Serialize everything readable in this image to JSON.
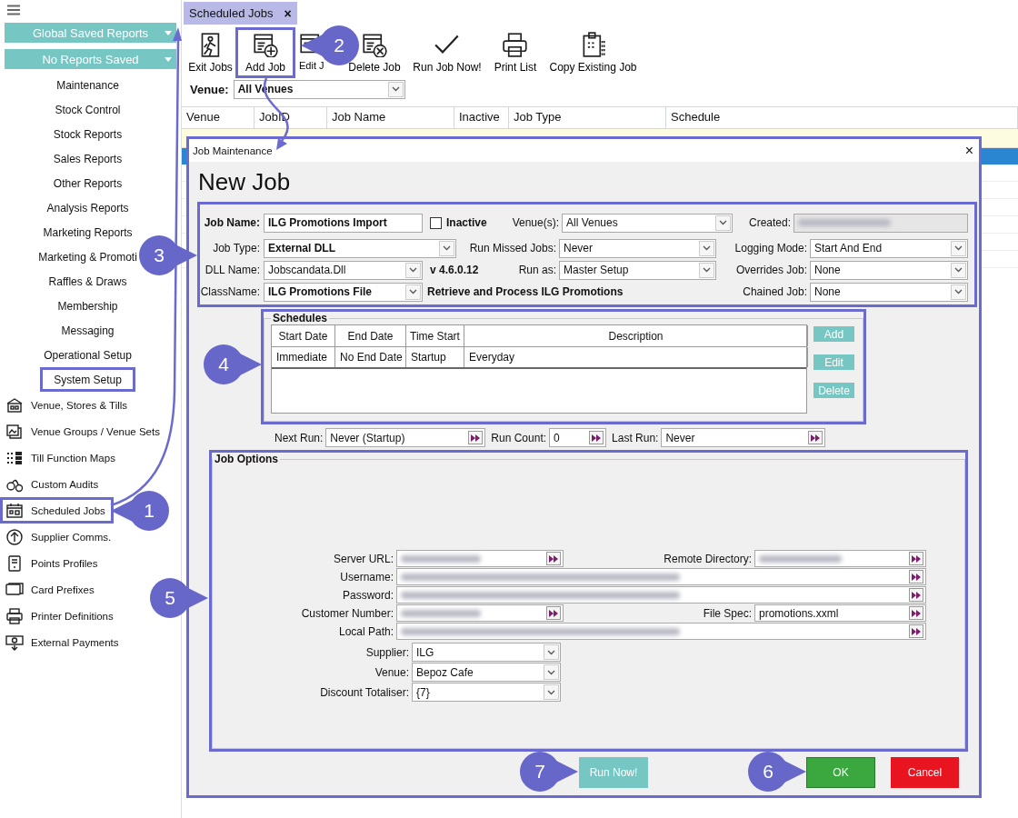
{
  "sidebar": {
    "report_selectors": [
      {
        "label": "Global Saved Reports"
      },
      {
        "label": "No Reports Saved"
      }
    ],
    "menu_items": [
      {
        "label": "Maintenance",
        "highlighted": false
      },
      {
        "label": "Stock Control",
        "highlighted": false
      },
      {
        "label": "Stock Reports",
        "highlighted": false
      },
      {
        "label": "Sales Reports",
        "highlighted": false
      },
      {
        "label": "Other Reports",
        "highlighted": false
      },
      {
        "label": "Analysis Reports",
        "highlighted": false
      },
      {
        "label": "Marketing Reports",
        "highlighted": false
      },
      {
        "label": "Marketing & Promoti",
        "highlighted": false
      },
      {
        "label": "Raffles & Draws",
        "highlighted": false
      },
      {
        "label": "Membership",
        "highlighted": false
      },
      {
        "label": "Messaging",
        "highlighted": false
      },
      {
        "label": "Operational Setup",
        "highlighted": false
      },
      {
        "label": "System Setup",
        "highlighted": true
      }
    ],
    "setup_items": [
      {
        "label": "Venue, Stores & Tills",
        "highlighted": false
      },
      {
        "label": "Venue Groups / Venue Sets",
        "highlighted": false
      },
      {
        "label": "Till Function Maps",
        "highlighted": false
      },
      {
        "label": "Custom Audits",
        "highlighted": false
      },
      {
        "label": "Scheduled Jobs",
        "highlighted": true
      },
      {
        "label": "Supplier Comms.",
        "highlighted": false
      },
      {
        "label": "Points Profiles",
        "highlighted": false
      },
      {
        "label": "Card Prefixes",
        "highlighted": false
      },
      {
        "label": "Printer Definitions",
        "highlighted": false
      },
      {
        "label": "External Payments",
        "highlighted": false
      }
    ]
  },
  "tab": {
    "label": "Scheduled Jobs",
    "close": "×"
  },
  "toolbar": [
    {
      "label": "Exit Jobs",
      "highlighted": false
    },
    {
      "label": "Add Job",
      "highlighted": true
    },
    {
      "label": "Edit J",
      "highlighted": false
    },
    {
      "label": "Delete Job",
      "highlighted": false
    },
    {
      "label": "Run Job Now!",
      "highlighted": false
    },
    {
      "label": "Print List",
      "highlighted": false
    },
    {
      "label": "Copy Existing Job",
      "highlighted": false
    }
  ],
  "venue_filter": {
    "label": "Venue:",
    "value": "All Venues"
  },
  "table": {
    "columns": [
      "Venue",
      "JobID",
      "Job Name",
      "Inactive",
      "Job Type",
      "Schedule"
    ]
  },
  "dialog": {
    "title": "Job Maintenance",
    "close": "×",
    "heading": "New Job",
    "job": {
      "job_name": {
        "label": "Job Name:",
        "value": "ILG Promotions Import"
      },
      "inactive": {
        "label": "Inactive",
        "checked": false
      },
      "venues": {
        "label": "Venue(s):",
        "value": "All Venues"
      },
      "created": {
        "label": "Created:",
        "redacted": true
      },
      "job_type": {
        "label": "Job Type:",
        "value": "External DLL"
      },
      "run_missed_jobs": {
        "label": "Run Missed Jobs:",
        "value": "Never"
      },
      "logging_mode": {
        "label": "Logging Mode:",
        "value": "Start And End"
      },
      "dll_name": {
        "label": "DLL Name:",
        "value": "Jobscandata.Dll"
      },
      "version": "v 4.6.0.12",
      "run_as": {
        "label": "Run as:",
        "value": "Master Setup"
      },
      "overrides_job": {
        "label": "Overrides Job:",
        "value": "None"
      },
      "class_name": {
        "label": "ClassName:",
        "value": "ILG Promotions File"
      },
      "class_description": "Retrieve and Process ILG Promotions",
      "chained_job": {
        "label": "Chained Job:",
        "value": "None"
      }
    },
    "schedules": {
      "title": "Schedules",
      "columns": [
        "Start Date",
        "End Date",
        "Time Start",
        "Description"
      ],
      "rows": [
        [
          "Immediate",
          "No End Date",
          "Startup",
          "Everyday"
        ]
      ],
      "buttons": [
        "Add",
        "Edit",
        "Delete"
      ]
    },
    "run_info": [
      {
        "label": "Next Run:",
        "value": "Never (Startup)"
      },
      {
        "label": "Run Count:",
        "value": "0"
      },
      {
        "label": "Last Run:",
        "value": "Never"
      }
    ],
    "job_options": {
      "title": "Job Options",
      "fields": [
        {
          "kind": "pair",
          "left": {
            "label": "Server URL:",
            "redacted": true
          },
          "right": {
            "label": "Remote Directory:",
            "redacted": true
          }
        },
        {
          "kind": "wide",
          "label": "Username:",
          "redacted": true
        },
        {
          "kind": "wide",
          "label": "Password:",
          "redacted": true
        },
        {
          "kind": "pair",
          "left": {
            "label": "Customer Number:",
            "redacted": true
          },
          "right": {
            "label": "File Spec:",
            "value": "promotions.xxml"
          }
        },
        {
          "kind": "wide",
          "label": "Local Path:",
          "redacted": true
        }
      ],
      "selects": [
        {
          "label": "Supplier:",
          "value": "ILG"
        },
        {
          "label": "Venue:",
          "value": "Bepoz Cafe"
        },
        {
          "label": "Discount Totaliser:",
          "value": "{7}"
        }
      ]
    },
    "buttons": [
      {
        "label": "Run Now!",
        "kind": "run"
      },
      {
        "label": "OK",
        "kind": "ok"
      },
      {
        "label": "Cancel",
        "kind": "cancel"
      }
    ]
  },
  "callouts": [
    {
      "number": "1"
    },
    {
      "number": "2"
    },
    {
      "number": "3"
    },
    {
      "number": "4"
    },
    {
      "number": "5"
    },
    {
      "number": "6"
    },
    {
      "number": "7"
    }
  ]
}
